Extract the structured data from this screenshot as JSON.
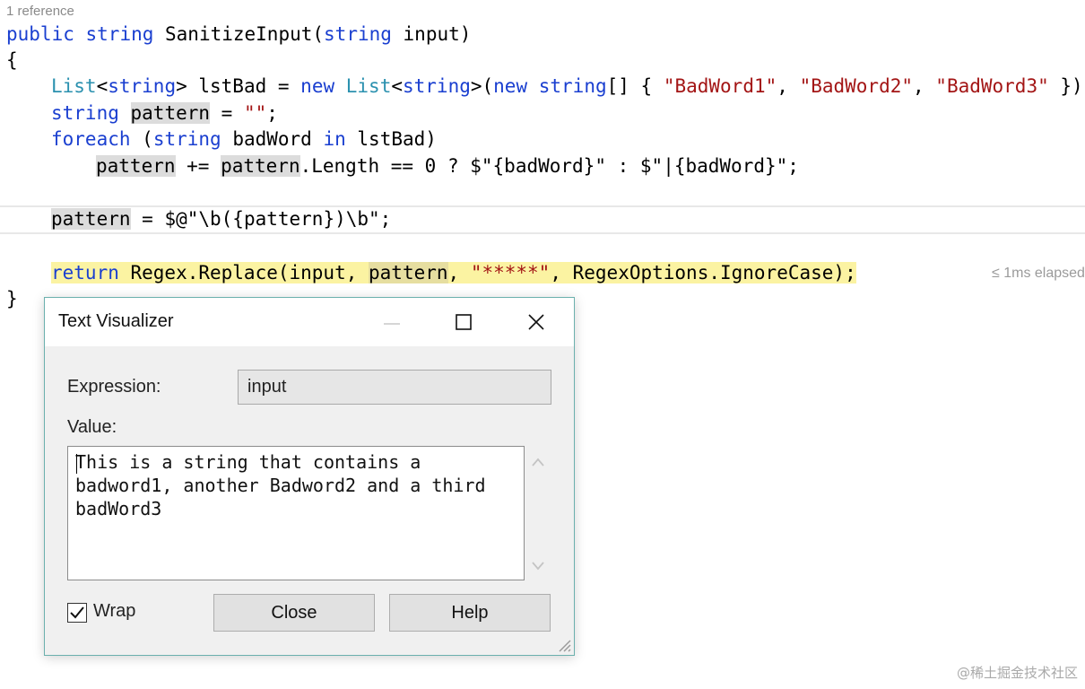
{
  "editor": {
    "codelens": "1 reference",
    "elapsed": "≤ 1ms elapsed",
    "lines": {
      "l1": {
        "kw1": "public",
        "kw2": "string",
        "name": " SanitizeInput(",
        "kw3": "string",
        "rest": " input)"
      },
      "l2": "{",
      "l3": {
        "ty1": "List",
        "p1": "<",
        "kw1": "string",
        "p2": "> lstBad = ",
        "kw2": "new",
        "sp": " ",
        "ty2": "List",
        "p3": "<",
        "kw3": "string",
        "p4": ">(",
        "kw4": "new",
        "sp2": " ",
        "kw5": "string",
        "p5": "[] { ",
        "s1": "\"BadWord1\"",
        "c1": ", ",
        "s2": "\"BadWord2\"",
        "c2": ", ",
        "s3": "\"BadWord3\"",
        "p6": " });"
      },
      "l4": {
        "kw": "string",
        "sp": " ",
        "ref": "pattern",
        "eq": " = ",
        "s": "\"\"",
        "end": ";"
      },
      "l5": {
        "kw1": "foreach",
        "p1": " (",
        "kw2": "string",
        "mid": " badWord ",
        "kw3": "in",
        "rest": " lstBad)"
      },
      "l6": {
        "ref1": "pattern",
        "mid1": " += ",
        "ref2": "pattern",
        "rest": ".Length == 0 ? $\"{badWord}\" : $\"|{badWord}\";"
      },
      "l7": {
        "ref": "pattern",
        "rest": " = $@\"\\b({pattern})\\b\";"
      },
      "l8": {
        "kw": "return",
        "a": " Regex.Replace(input, ",
        "ref": "pattern",
        "b": ", ",
        "s": "\"*****\"",
        "c": ", RegexOptions.IgnoreCase);"
      },
      "l9": "}"
    }
  },
  "dialog": {
    "title": "Text Visualizer",
    "expression_label": "Expression:",
    "expression_value": "input",
    "value_label": "Value:",
    "value_text": "This is a string that contains a\nbadword1, another Badword2 and a third\nbadWord3",
    "wrap_label": "Wrap",
    "wrap_checked": true,
    "close_label": "Close",
    "help_label": "Help"
  },
  "watermark": "@稀土掘金技术社区",
  "colors": {
    "keyword": "#1a3fd0",
    "type": "#2b91af",
    "string": "#a31515",
    "current_statement": "#fbf3a2",
    "reference_highlight": "#dcdcdc",
    "dialog_border": "#6bb0ad"
  }
}
